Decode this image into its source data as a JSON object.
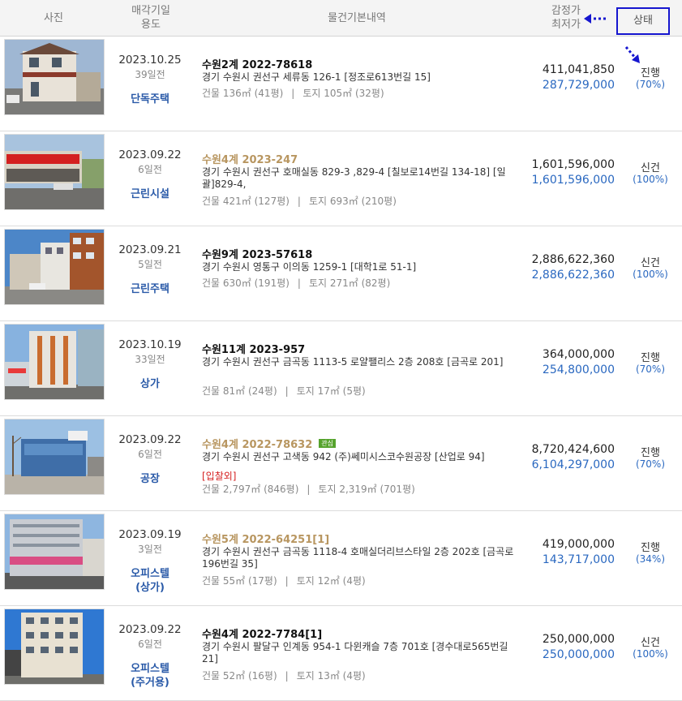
{
  "header": {
    "photo": "사진",
    "date_l1": "매각기일",
    "date_l2": "용도",
    "info": "물건기본내역",
    "price_l1": "감정가",
    "price_l2": "최저가",
    "status": "상태"
  },
  "accent_colors": {
    "highlight_box": "#1616cf",
    "usage_text": "#2a5aa8",
    "min_price": "#2a68c0",
    "gold_case": "#b89660",
    "flag": "#d52020",
    "fav_badge": "#56a32d"
  },
  "rows": [
    {
      "date": "2023.10.25",
      "ago": "39일전",
      "usage": "단독주택",
      "usage2": "",
      "case": "수원2계 2022-78618",
      "case_style": "normal",
      "badge": "",
      "addr": "경기 수원시 권선구 세류동 126-1 [정조로613번길 15]",
      "flag": "",
      "bld": "건물 136㎡ (41평)",
      "land": "토지 105㎡ (32평)",
      "appraisal": "411,041,850",
      "minimum": "287,729,000",
      "status": "진행",
      "percent": "(70%)",
      "photo_icon": "house-photo"
    },
    {
      "date": "2023.09.22",
      "ago": "6일전",
      "usage": "근린시설",
      "usage2": "",
      "case": "수원4계 2023-247",
      "case_style": "gold",
      "badge": "",
      "addr": "경기 수원시 권선구 호매실동 829-3 ,829-4 [칠보로14번길 134-18] [일괄]829-4,",
      "flag": "",
      "bld": "건물 421㎡ (127평)",
      "land": "토지 693㎡ (210평)",
      "appraisal": "1,601,596,000",
      "minimum": "1,601,596,000",
      "status": "신건",
      "percent": "(100%)",
      "photo_icon": "shop-photo"
    },
    {
      "date": "2023.09.21",
      "ago": "5일전",
      "usage": "근린주택",
      "usage2": "",
      "case": "수원9계 2023-57618",
      "case_style": "normal",
      "badge": "",
      "addr": "경기 수원시 영통구 이의동 1259-1 [대학1로 51-1]",
      "flag": "",
      "bld": "건물 630㎡ (191평)",
      "land": "토지 271㎡ (82평)",
      "appraisal": "2,886,622,360",
      "minimum": "2,886,622,360",
      "status": "신건",
      "percent": "(100%)",
      "photo_icon": "building-photo"
    },
    {
      "date": "2023.10.19",
      "ago": "33일전",
      "usage": "상가",
      "usage2": "",
      "case": "수원11계 2023-957",
      "case_style": "normal",
      "badge": "",
      "addr": "경기 수원시 권선구 금곡동 1113-5 로얄팰리스 2층 208호 [금곡로 201]",
      "flag": "",
      "bld": "건물 81㎡ (24평)",
      "land": "토지 17㎡ (5평)",
      "appraisal": "364,000,000",
      "minimum": "254,800,000",
      "status": "진행",
      "percent": "(70%)",
      "photo_icon": "tower-photo"
    },
    {
      "date": "2023.09.22",
      "ago": "6일전",
      "usage": "공장",
      "usage2": "",
      "case": "수원4계 2022-78632",
      "case_style": "gold",
      "badge": "관심",
      "addr": "경기 수원시 권선구 고색동 942 (주)쎄미시스코수원공장 [산업로 94]",
      "flag": "[입찰외]",
      "bld": "건물 2,797㎡ (846평)",
      "land": "토지 2,319㎡ (701평)",
      "appraisal": "8,720,424,600",
      "minimum": "6,104,297,000",
      "status": "진행",
      "percent": "(70%)",
      "photo_icon": "factory-photo"
    },
    {
      "date": "2023.09.19",
      "ago": "3일전",
      "usage": "오피스텔",
      "usage2": "(상가)",
      "case": "수원5계 2022-64251[1]",
      "case_style": "gold",
      "badge": "",
      "addr": "경기 수원시 권선구 금곡동 1118-4 호매실더리브스타일 2층 202호 [금곡로196번길 35]",
      "flag": "",
      "bld": "건물 55㎡ (17평)",
      "land": "토지 12㎡ (4평)",
      "appraisal": "419,000,000",
      "minimum": "143,717,000",
      "status": "진행",
      "percent": "(34%)",
      "photo_icon": "office-photo"
    },
    {
      "date": "2023.09.22",
      "ago": "6일전",
      "usage": "오피스텔",
      "usage2": "(주거용)",
      "case": "수원4계 2022-7784[1]",
      "case_style": "normal",
      "badge": "",
      "addr": "경기 수원시 팔달구 인계동 954-1 다윈캐슬 7층 701호 [경수대로565번길 21]",
      "flag": "",
      "bld": "건물 52㎡ (16평)",
      "land": "토지 13㎡ (4평)",
      "appraisal": "250,000,000",
      "minimum": "250,000,000",
      "status": "신건",
      "percent": "(100%)",
      "photo_icon": "apartment-photo"
    }
  ]
}
